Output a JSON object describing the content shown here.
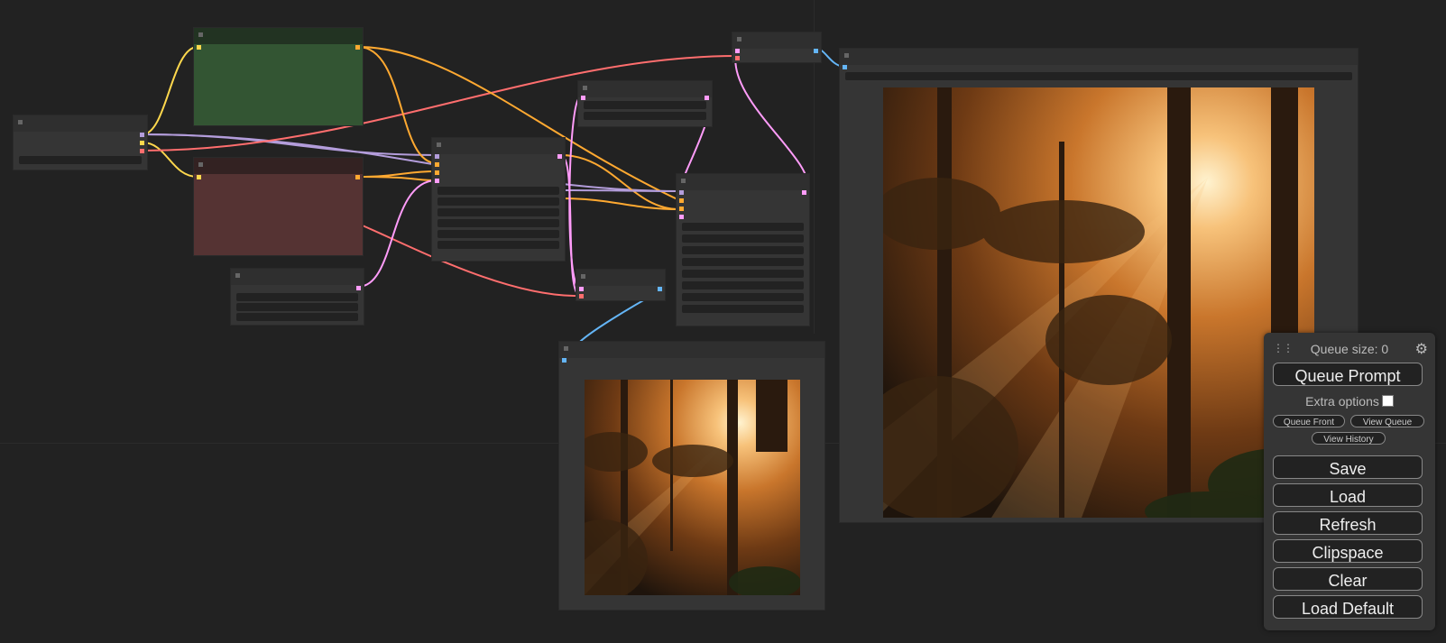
{
  "menu": {
    "queue_size": "Queue size: 0",
    "queue_prompt": "Queue Prompt",
    "extra_options": "Extra options",
    "extra_options_checked": false,
    "queue_front": "Queue Front",
    "view_queue": "View Queue",
    "view_history": "View History",
    "save": "Save",
    "load": "Load",
    "refresh": "Refresh",
    "clipspace": "Clipspace",
    "clear": "Clear",
    "load_default": "Load Default"
  },
  "colors": {
    "canvas_bg": "#222222",
    "node_bg": "#353535",
    "positive_node": "#335533",
    "negative_node": "#553333",
    "link_clip": "#ffd84d",
    "link_conditioning": "#ffa931",
    "link_model": "#b39ddb",
    "link_vae": "#ff6e6e",
    "link_latent": "#ff9cf9",
    "link_image": "#64b5f6"
  },
  "icons": {
    "drag_handle": "drag-handle-icon",
    "settings": "gear-icon"
  }
}
